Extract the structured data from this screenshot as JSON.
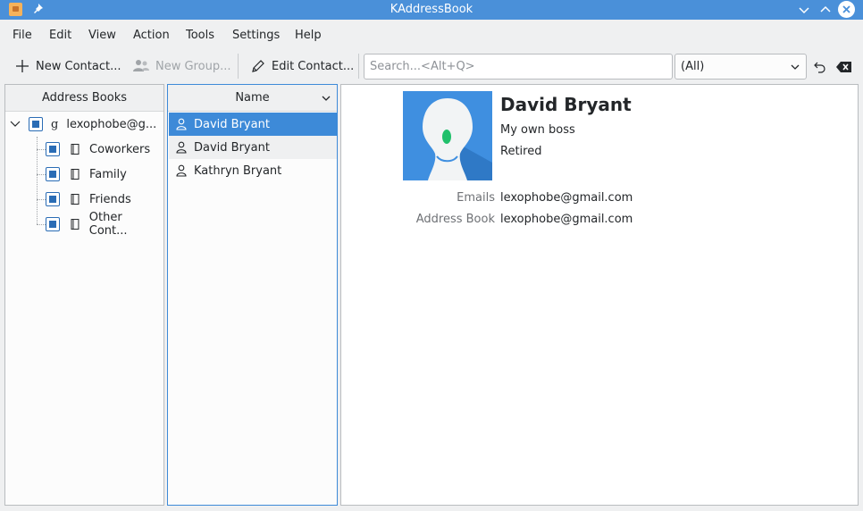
{
  "window": {
    "title": "KAddressBook"
  },
  "menu": [
    "File",
    "Edit",
    "View",
    "Action",
    "Tools",
    "Settings",
    "Help"
  ],
  "toolbar": {
    "new_contact": "New Contact...",
    "new_group": "New Group...",
    "edit_contact": "Edit Contact...",
    "search_placeholder": "Search...<Alt+Q>",
    "filter_value": "(All)"
  },
  "address_books": {
    "header": "Address Books",
    "root": "lexophobe@g...",
    "children": [
      "Coworkers",
      "Family",
      "Friends",
      "Other Cont..."
    ]
  },
  "contacts": {
    "header": "Name",
    "items": [
      "David Bryant",
      "David Bryant",
      "Kathryn Bryant"
    ],
    "selected_index": 0
  },
  "details": {
    "name": "David Bryant",
    "organization": "My own boss",
    "title": "Retired",
    "fields": [
      {
        "label": "Emails",
        "value": "lexophobe@gmail.com"
      },
      {
        "label": "Address Book",
        "value": "lexophobe@gmail.com"
      }
    ]
  },
  "colors": {
    "accent": "#3d8ad8",
    "titlebar": "#4a90d9",
    "avatar_bg": "#3f8fe0"
  }
}
